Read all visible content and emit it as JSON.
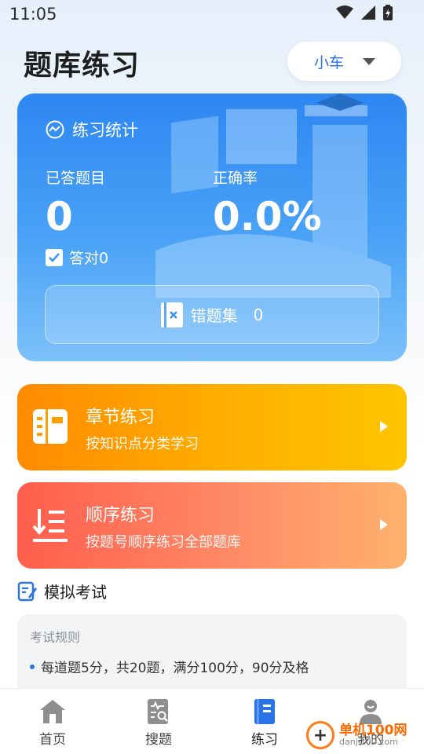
{
  "status_bar": {
    "time": "11:05"
  },
  "header": {
    "title": "题库练习",
    "vehicle_select": "小车"
  },
  "stats": {
    "heading": "练习统计",
    "answered_label": "已答题目",
    "answered_value": "0",
    "accuracy_label": "正确率",
    "accuracy_value": "0.0%",
    "correct_label": "答对0",
    "wrong_set_label": "错题集",
    "wrong_set_count": "0"
  },
  "practice": {
    "chapter": {
      "title": "章节练习",
      "subtitle": "按知识点分类学习"
    },
    "order": {
      "title": "顺序练习",
      "subtitle": "按题号顺序练习全部题库"
    }
  },
  "mock_exam": {
    "heading": "模拟考试",
    "rules_title": "考试规则",
    "rules_line": "每道题5分，共20题，满分100分，90分及格"
  },
  "nav": {
    "items": [
      {
        "label": "首页",
        "icon": "home-icon"
      },
      {
        "label": "搜题",
        "icon": "search-doc-icon"
      },
      {
        "label": "练习",
        "icon": "book-icon",
        "active": true
      },
      {
        "label": "我的",
        "icon": "user-icon"
      }
    ]
  },
  "watermark": {
    "brand": "单机100网",
    "url": "danji100.com"
  },
  "colors": {
    "accent": "#2a72e8",
    "stats_card": "#2e87f2",
    "chapter_card": "#ff9a00",
    "order_card": "#ff6a55"
  }
}
